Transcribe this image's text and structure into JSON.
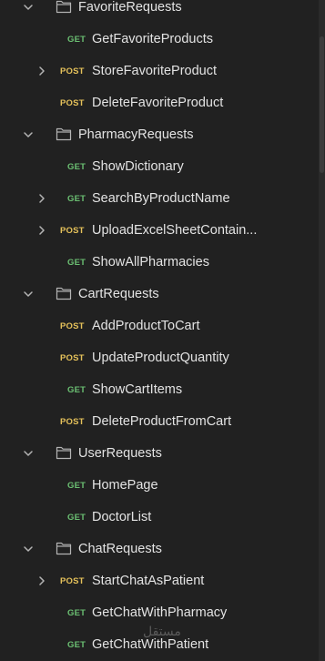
{
  "tree": [
    {
      "kind": "folder",
      "label": "FavoriteRequests",
      "chevron": "down"
    },
    {
      "kind": "request",
      "method": "GET",
      "label": "GetFavoriteProducts",
      "chevron": "none"
    },
    {
      "kind": "request",
      "method": "POST",
      "label": "StoreFavoriteProduct",
      "chevron": "right"
    },
    {
      "kind": "request",
      "method": "POST",
      "label": "DeleteFavoriteProduct",
      "chevron": "none"
    },
    {
      "kind": "folder",
      "label": "PharmacyRequests",
      "chevron": "down"
    },
    {
      "kind": "request",
      "method": "GET",
      "label": "ShowDictionary",
      "chevron": "none"
    },
    {
      "kind": "request",
      "method": "GET",
      "label": "SearchByProductName",
      "chevron": "right"
    },
    {
      "kind": "request",
      "method": "POST",
      "label": "UploadExcelSheetContain...",
      "chevron": "right"
    },
    {
      "kind": "request",
      "method": "GET",
      "label": "ShowAllPharmacies",
      "chevron": "none"
    },
    {
      "kind": "folder",
      "label": "CartRequests",
      "chevron": "down"
    },
    {
      "kind": "request",
      "method": "POST",
      "label": "AddProductToCart",
      "chevron": "none"
    },
    {
      "kind": "request",
      "method": "POST",
      "label": "UpdateProductQuantity",
      "chevron": "none"
    },
    {
      "kind": "request",
      "method": "GET",
      "label": "ShowCartItems",
      "chevron": "none"
    },
    {
      "kind": "request",
      "method": "POST",
      "label": "DeleteProductFromCart",
      "chevron": "none"
    },
    {
      "kind": "folder",
      "label": "UserRequests",
      "chevron": "down"
    },
    {
      "kind": "request",
      "method": "GET",
      "label": "HomePage",
      "chevron": "none"
    },
    {
      "kind": "request",
      "method": "GET",
      "label": "DoctorList",
      "chevron": "none"
    },
    {
      "kind": "folder",
      "label": "ChatRequests",
      "chevron": "down"
    },
    {
      "kind": "request",
      "method": "POST",
      "label": "StartChatAsPatient",
      "chevron": "right"
    },
    {
      "kind": "request",
      "method": "GET",
      "label": "GetChatWithPharmacy",
      "chevron": "none"
    },
    {
      "kind": "request",
      "method": "GET",
      "label": "GetChatWithPatient",
      "chevron": "none"
    }
  ],
  "colors": {
    "background": "#212121",
    "text": "#e3e3e3",
    "get": "#6bbf72",
    "post": "#e5c15a",
    "icon": "#b4b4b4"
  },
  "icons": {
    "folder": "folder-icon",
    "expanded": "chevron-down-icon",
    "collapsed": "chevron-right-icon"
  },
  "watermark": "مستقل"
}
